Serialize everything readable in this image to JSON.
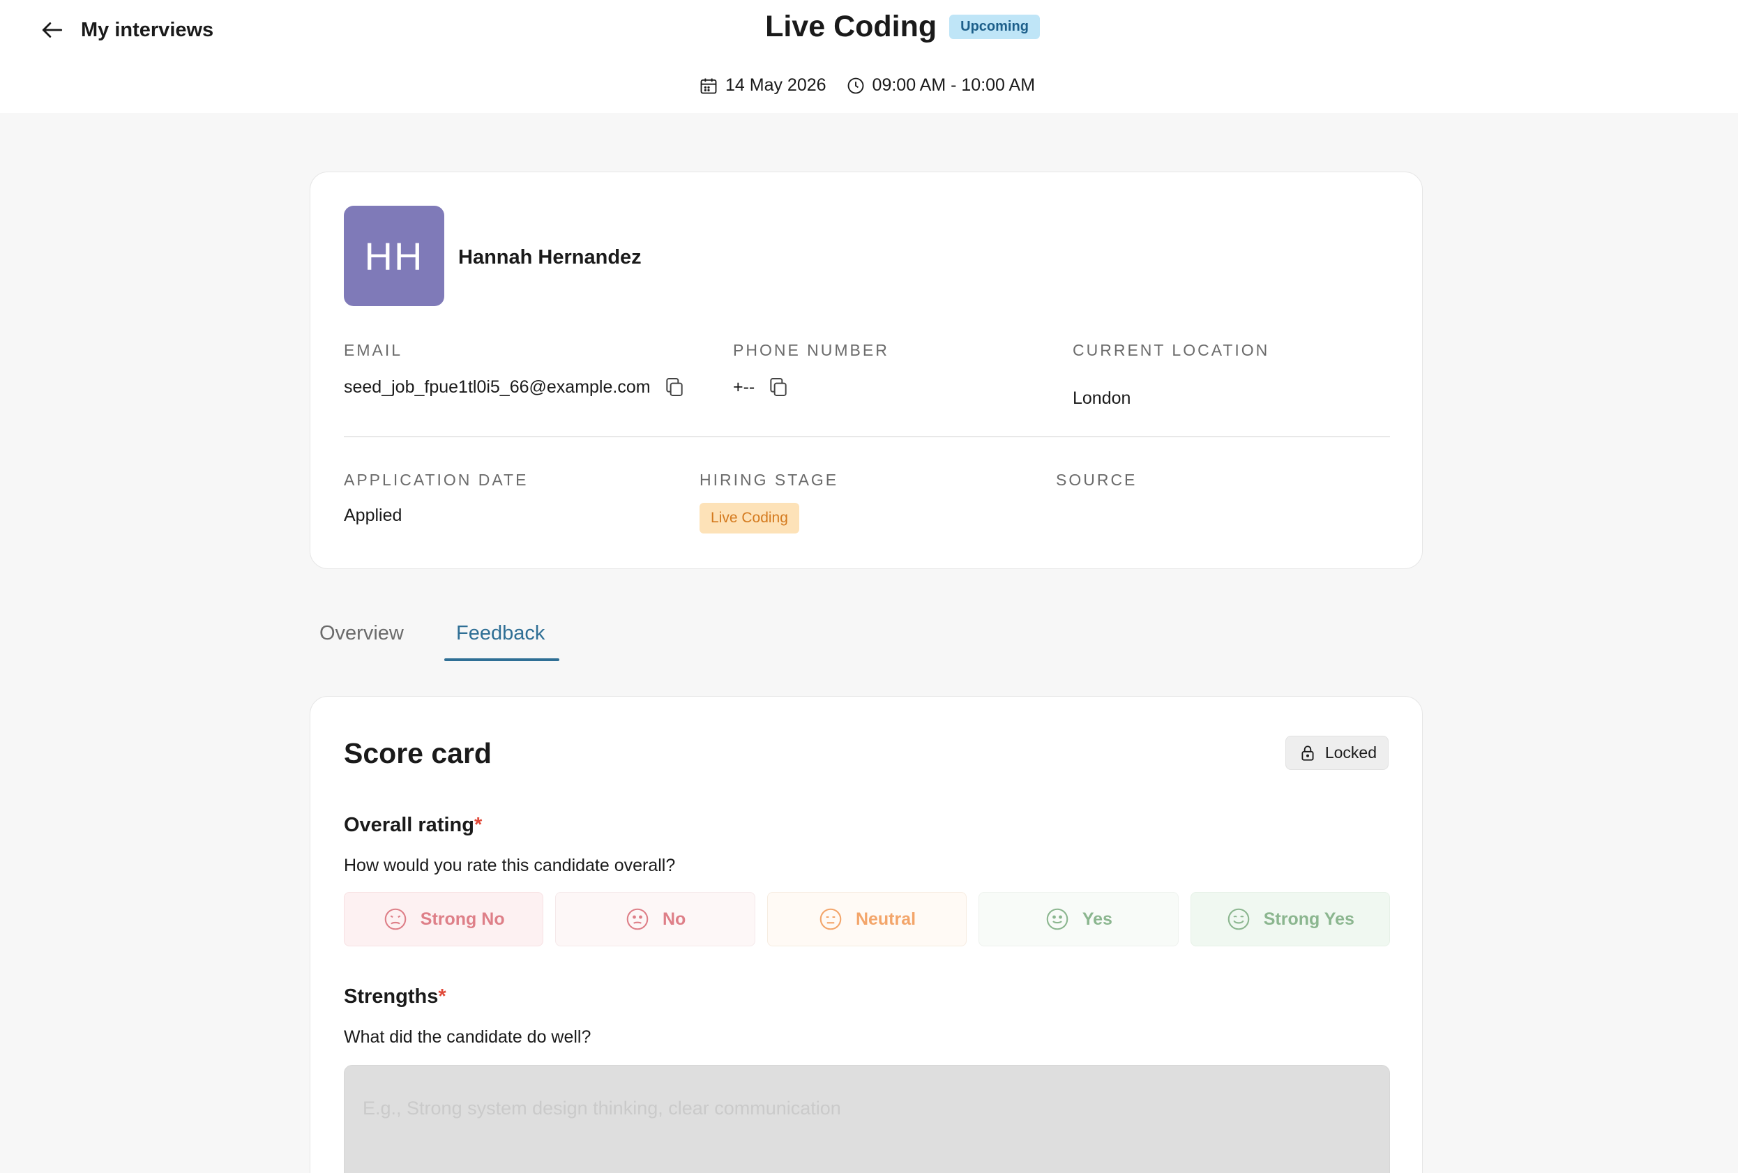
{
  "header": {
    "back_label": "My interviews",
    "title": "Live Coding",
    "status": "Upcoming",
    "date": "14 May 2026",
    "time": "09:00 AM - 10:00 AM"
  },
  "candidate": {
    "initials": "HH",
    "name": "Hannah Hernandez",
    "avatar_color": "#7f7ab8",
    "fields": {
      "email_label": "EMAIL",
      "email": "seed_job_fpue1tl0i5_66@example.com",
      "phone_label": "PHONE NUMBER",
      "phone": "+--",
      "location_label": "CURRENT LOCATION",
      "location": "London",
      "application_date_label": "APPLICATION DATE",
      "application_date": "Applied",
      "hiring_stage_label": "HIRING STAGE",
      "hiring_stage": "Live Coding",
      "source_label": "SOURCE"
    }
  },
  "tabs": {
    "overview": "Overview",
    "feedback": "Feedback",
    "active": "feedback"
  },
  "scorecard": {
    "title": "Score card",
    "locked_label": "Locked",
    "overall": {
      "title": "Overall rating",
      "required_mark": "*",
      "question": "How would you rate this candidate overall?",
      "options": [
        "Strong No",
        "No",
        "Neutral",
        "Yes",
        "Strong Yes"
      ]
    },
    "strengths": {
      "title": "Strengths",
      "required_mark": "*",
      "question": "What did the candidate do well?",
      "placeholder": "E.g., Strong system design thinking, clear communication"
    }
  },
  "colors": {
    "accent": "#2f6f95",
    "status_badge_bg": "#bfe5f7",
    "stage_badge_bg": "#fde2b8",
    "required": "#e04a3a"
  }
}
